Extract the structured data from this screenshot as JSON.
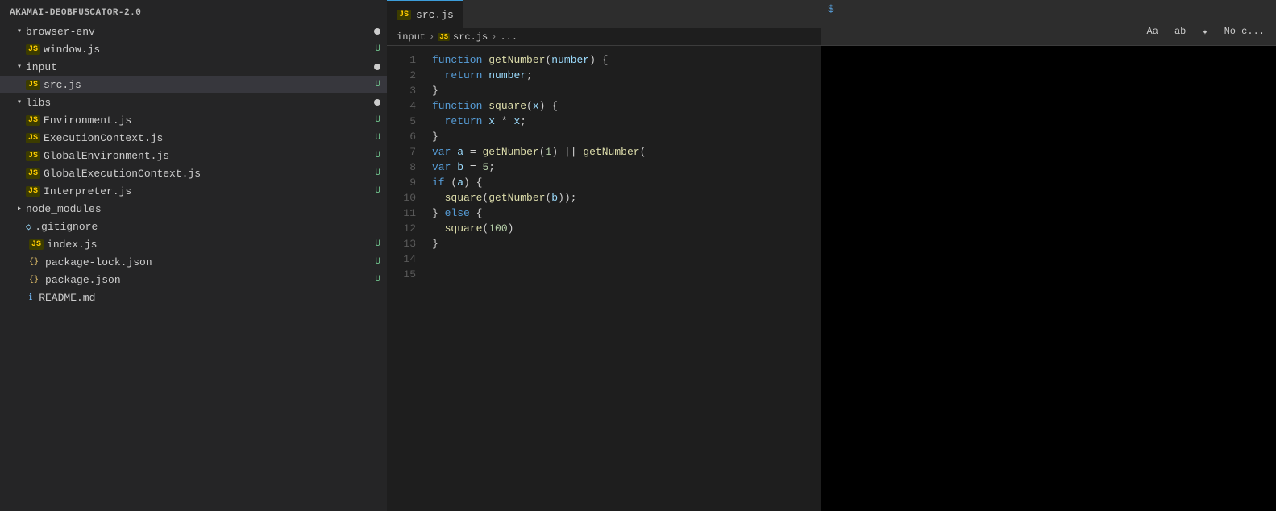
{
  "sidebar": {
    "title": "AKAMAI-DEOBFUSCATOR-2.0",
    "items": [
      {
        "id": "browser-env",
        "type": "folder",
        "label": "browser-env",
        "indent": 1,
        "expanded": true,
        "badge": "",
        "dot": true
      },
      {
        "id": "window-js",
        "type": "js-file",
        "label": "window.js",
        "indent": 2,
        "badge": "U"
      },
      {
        "id": "input",
        "type": "folder",
        "label": "input",
        "indent": 1,
        "expanded": true,
        "badge": "",
        "dot": true
      },
      {
        "id": "src-js",
        "type": "js-file",
        "label": "src.js",
        "indent": 2,
        "badge": "U",
        "selected": true
      },
      {
        "id": "libs",
        "type": "folder",
        "label": "libs",
        "indent": 1,
        "expanded": true,
        "badge": "",
        "dot": true
      },
      {
        "id": "environment-js",
        "type": "js-file",
        "label": "Environment.js",
        "indent": 2,
        "badge": "U"
      },
      {
        "id": "executioncontext-js",
        "type": "js-file",
        "label": "ExecutionContext.js",
        "indent": 2,
        "badge": "U"
      },
      {
        "id": "globalenvironment-js",
        "type": "js-file",
        "label": "GlobalEnvironment.js",
        "indent": 2,
        "badge": "U"
      },
      {
        "id": "globalexecutioncontext-js",
        "type": "js-file",
        "label": "GlobalExecutionContext.js",
        "indent": 2,
        "badge": "U"
      },
      {
        "id": "interpreter-js",
        "type": "js-file",
        "label": "Interpreter.js",
        "indent": 2,
        "badge": "U"
      },
      {
        "id": "node-modules",
        "type": "folder",
        "label": "node_modules",
        "indent": 1,
        "expanded": false,
        "badge": ""
      },
      {
        "id": "gitignore",
        "type": "special-file",
        "label": ".gitignore",
        "indent": 1,
        "badge": ""
      },
      {
        "id": "index-js",
        "type": "js-file",
        "label": "index.js",
        "indent": 1,
        "badge": "U"
      },
      {
        "id": "package-lock-json",
        "type": "json-file",
        "label": "package-lock.json",
        "indent": 1,
        "badge": "U"
      },
      {
        "id": "package-json",
        "type": "json-file",
        "label": "package.json",
        "indent": 1,
        "badge": "U"
      },
      {
        "id": "readme-md",
        "type": "info-file",
        "label": "README.md",
        "indent": 1,
        "badge": ""
      }
    ]
  },
  "editor": {
    "tab_label": "src.js",
    "breadcrumb": [
      "input",
      "JS src.js",
      "..."
    ],
    "lines": [
      {
        "num": 1,
        "code": "function getNumber(number) {"
      },
      {
        "num": 2,
        "code": "  return number;"
      },
      {
        "num": 3,
        "code": "}"
      },
      {
        "num": 4,
        "code": ""
      },
      {
        "num": 5,
        "code": "function square(x) {"
      },
      {
        "num": 6,
        "code": "  return x * x;"
      },
      {
        "num": 7,
        "code": "}"
      },
      {
        "num": 8,
        "code": ""
      },
      {
        "num": 9,
        "code": "var a = getNumber(1) || getNumber("
      },
      {
        "num": 10,
        "code": "var b = 5;"
      },
      {
        "num": 11,
        "code": "if (a) {"
      },
      {
        "num": 12,
        "code": "  square(getNumber(b));"
      },
      {
        "num": 13,
        "code": "} else {"
      },
      {
        "num": 14,
        "code": "  square(100)"
      },
      {
        "num": 15,
        "code": "}"
      }
    ]
  },
  "right_panel": {
    "terminal_prompt": "$",
    "toolbar": {
      "btn1": "Aa",
      "btn2": "ab",
      "btn3": "✦",
      "btn4": "No c..."
    }
  }
}
